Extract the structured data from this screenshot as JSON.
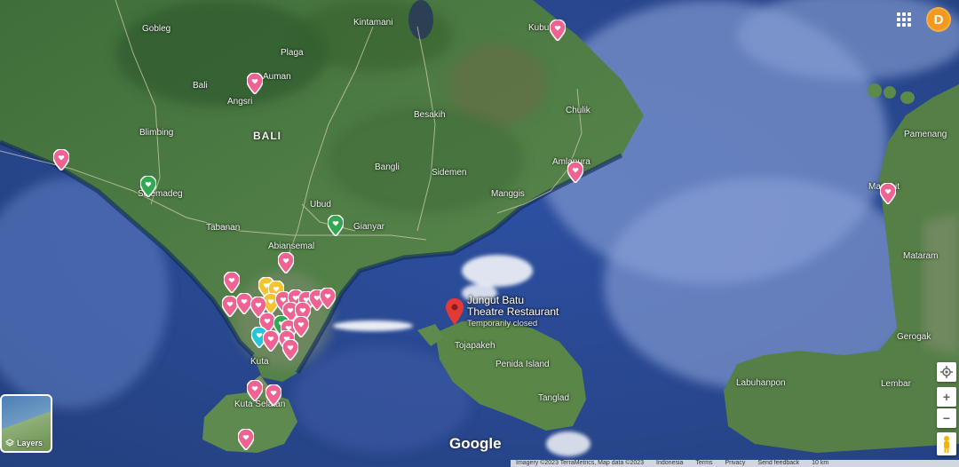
{
  "map": {
    "place_labels": [
      {
        "text": "Gobleg",
        "type": "town"
      },
      {
        "text": "Kintamani",
        "type": "town"
      },
      {
        "text": "Kubu",
        "type": "town"
      },
      {
        "text": "Plaga",
        "type": "town"
      },
      {
        "text": "Bali",
        "type": "town"
      },
      {
        "text": "Auman",
        "type": "town"
      },
      {
        "text": "Angsri",
        "type": "town"
      },
      {
        "text": "BALI",
        "type": "region"
      },
      {
        "text": "Blimbing",
        "type": "town"
      },
      {
        "text": "Besakih",
        "type": "town"
      },
      {
        "text": "Chulik",
        "type": "town"
      },
      {
        "text": "Bangli",
        "type": "town"
      },
      {
        "text": "Sidemen",
        "type": "town"
      },
      {
        "text": "Amlapura",
        "type": "town"
      },
      {
        "text": "Selemadeg",
        "type": "town"
      },
      {
        "text": "Manggis",
        "type": "town"
      },
      {
        "text": "Ubud",
        "type": "town"
      },
      {
        "text": "Gianyar",
        "type": "town"
      },
      {
        "text": "Tabanan",
        "type": "town"
      },
      {
        "text": "Abiansemal",
        "type": "town"
      },
      {
        "text": "Kuta",
        "type": "town"
      },
      {
        "text": "Kuta Selatan",
        "type": "town"
      },
      {
        "text": "Tojapakeh",
        "type": "town"
      },
      {
        "text": "Penida Island",
        "type": "town"
      },
      {
        "text": "Tanglad",
        "type": "town"
      },
      {
        "text": "Pamenang",
        "type": "town"
      },
      {
        "text": "Mangsit",
        "type": "town"
      },
      {
        "text": "Mataram",
        "type": "town"
      },
      {
        "text": "Gerogak",
        "type": "town"
      },
      {
        "text": "Labuhanpon",
        "type": "town"
      },
      {
        "text": "Lembar",
        "type": "town"
      }
    ],
    "selected_place": {
      "name_line1": "Jungut Batu",
      "name_line2": "Theatre Restaurant",
      "status": "Temporarily closed",
      "marker_color": "#e53935"
    },
    "pin_colors": {
      "saved": "#f06292",
      "want_to_go": "#f4c430",
      "green": "#33a852",
      "teal": "#26c6da"
    }
  },
  "branding": {
    "logo": "Google"
  },
  "footer": {
    "items": [
      "Imagery ©2023 TerraMetrics, Map data ©2023",
      "Indonesia",
      "Terms",
      "Privacy",
      "Send feedback",
      "10 km"
    ]
  },
  "header": {
    "apps_icon": "apps-grid-icon",
    "avatar_letter": "D",
    "avatar_color": "#f39a1e"
  },
  "controls": {
    "zoom_in": "+",
    "zoom_out": "−",
    "my_location_icon": "my-location-icon",
    "pegman_icon": "pegman-icon"
  },
  "layers": {
    "label": "Layers"
  }
}
